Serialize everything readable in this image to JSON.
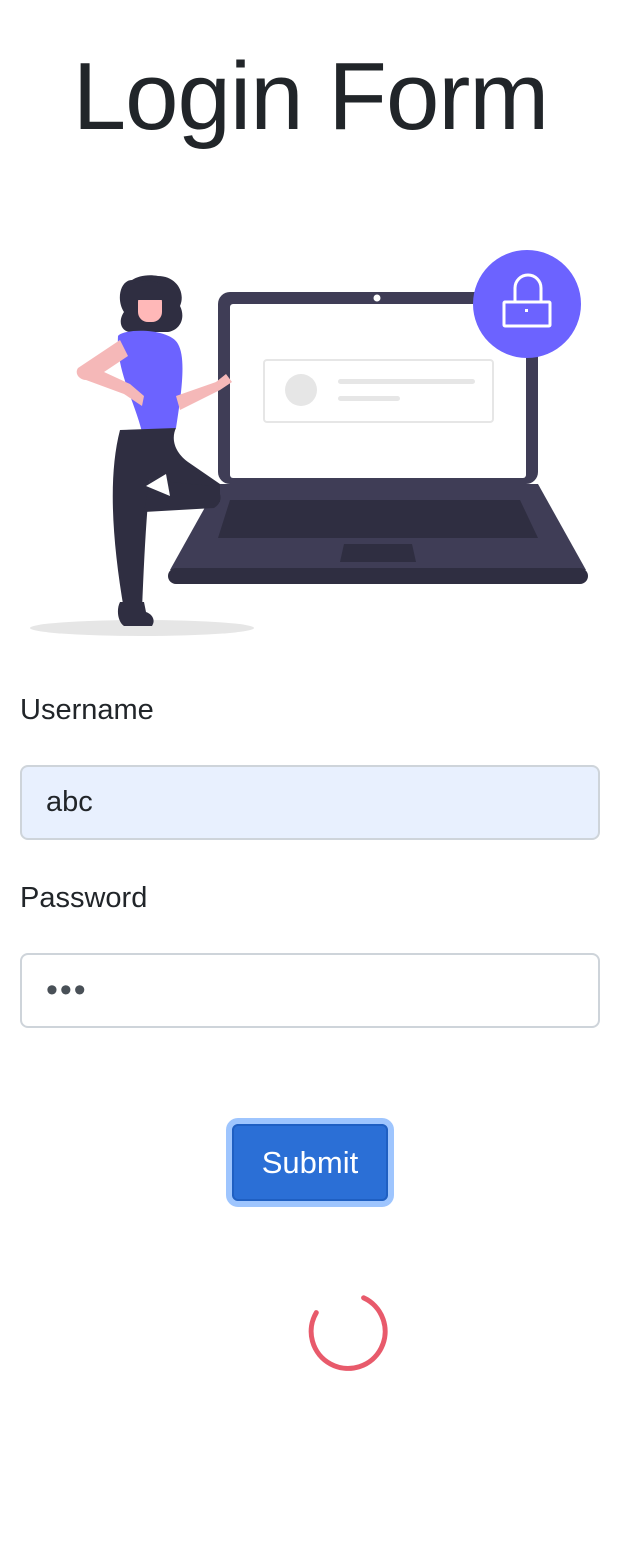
{
  "page": {
    "title": "Login Form"
  },
  "illustration": {
    "icon": "login-illustration",
    "accent_color": "#6c63ff"
  },
  "form": {
    "username": {
      "label": "Username",
      "value": "abc"
    },
    "password": {
      "label": "Password",
      "value": "•••"
    },
    "submit_label": "Submit"
  },
  "status": {
    "loading_indicator": "spinner-icon",
    "spinner_color": "#e85a6b"
  },
  "colors": {
    "primary": "#2b6fd6",
    "focus_ring": "#9ec5fe",
    "autofill_bg": "#e8f0fe"
  }
}
